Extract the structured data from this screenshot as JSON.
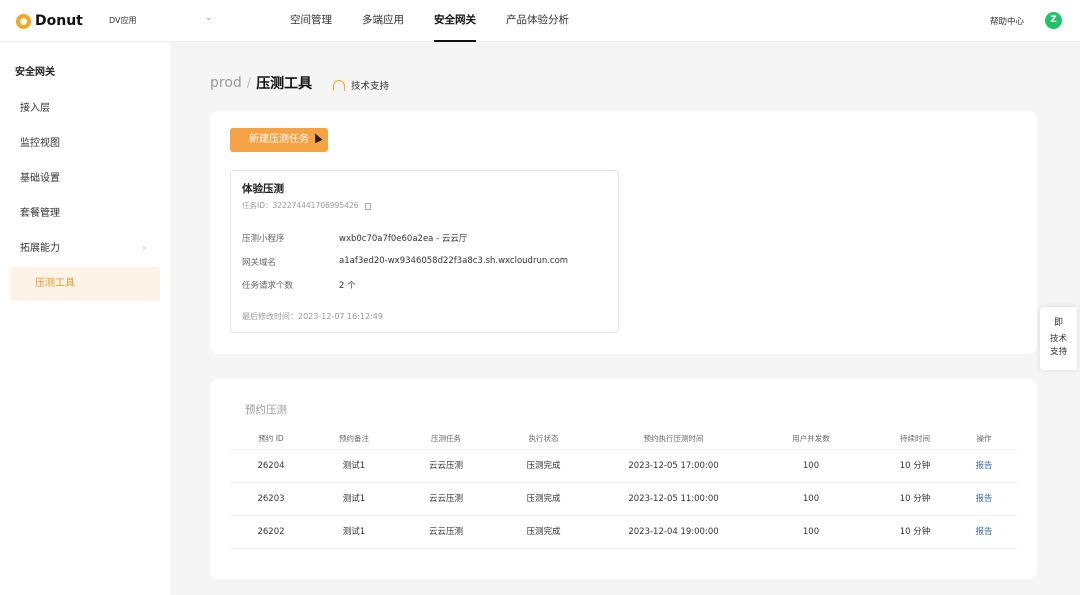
{
  "topbar": {
    "brand": "Donut",
    "app_selector": "DV应用",
    "nav": [
      "空间管理",
      "多端应用",
      "安全网关",
      "产品体验分析"
    ],
    "active_nav_index": 2,
    "help": "帮助中心",
    "avatar_letter": "Z"
  },
  "sidebar": {
    "title": "安全网关",
    "items": [
      {
        "label": "接入层"
      },
      {
        "label": "监控视图"
      },
      {
        "label": "基础设置"
      },
      {
        "label": "套餐管理"
      },
      {
        "label": "拓展能力"
      },
      {
        "label": "压测工具"
      }
    ]
  },
  "breadcrumb": {
    "env": "prod",
    "separator": "/",
    "title": "压测工具",
    "support": "技术支持"
  },
  "task_card": {
    "new_button": "新建压测任务",
    "name": "体验压测",
    "id_label": "任务ID：",
    "id_value": "322274441706995426",
    "fields": [
      {
        "label": "压测小程序",
        "value": "wxb0c70a7f0e60a2ea - 云云厅"
      },
      {
        "label": "网关域名",
        "value": "a1af3ed20-wx9346058d22f3a8c3.sh.wxcloudrun.com"
      },
      {
        "label": "任务请求个数",
        "value": "2 个"
      }
    ],
    "modified_label": "最后修改时间：",
    "modified_value": "2023-12-07 16:12:49"
  },
  "float_support": {
    "icon_text": "即",
    "line1": "技术",
    "line2": "支持"
  },
  "schedule": {
    "title": "预约压测",
    "columns": [
      "预约 ID",
      "预约备注",
      "压测任务",
      "执行状态",
      "预约执行压测时间",
      "用户并发数",
      "持续时间",
      "操作"
    ],
    "rows": [
      [
        "26204",
        "测试1",
        "云云压测",
        "压测完成",
        "2023-12-05 17:00:00",
        "100",
        "10 分钟",
        "报告"
      ],
      [
        "26203",
        "测试1",
        "云云压测",
        "压测完成",
        "2023-12-05 11:00:00",
        "100",
        "10 分钟",
        "报告"
      ],
      [
        "26202",
        "测试1",
        "云云压测",
        "压测完成",
        "2023-12-04 19:00:00",
        "100",
        "10 分钟",
        "报告"
      ]
    ]
  },
  "colors": {
    "accent": "#f5a244",
    "sidebar_active_bg": "#fdf3e6",
    "link": "#3d6fb8",
    "avatar": "#1ec36b"
  }
}
